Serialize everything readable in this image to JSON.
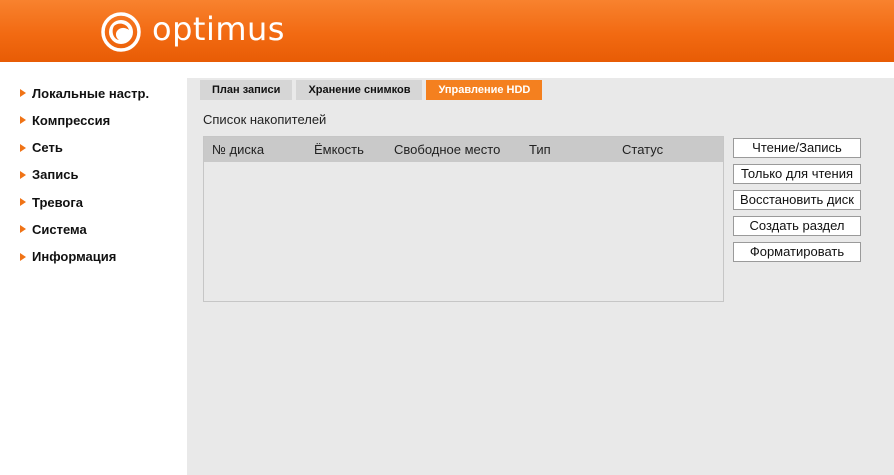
{
  "header": {
    "brand": "optimus",
    "logo_icon": "optimus-logo-icon",
    "brand_color": "#f26a12"
  },
  "menu": {
    "items": [
      {
        "label": "Локальные настр."
      },
      {
        "label": "Компрессия"
      },
      {
        "label": "Сеть"
      },
      {
        "label": "Запись"
      },
      {
        "label": "Тревога"
      },
      {
        "label": "Система"
      },
      {
        "label": "Информация"
      }
    ]
  },
  "tabs": [
    {
      "label": "План записи",
      "active": false
    },
    {
      "label": "Хранение снимков",
      "active": false
    },
    {
      "label": "Управление HDD",
      "active": true
    }
  ],
  "storage": {
    "title": "Список накопителей",
    "columns": [
      "№ диска",
      "Ёмкость",
      "Свободное место",
      "Тип",
      "Статус"
    ],
    "rows": []
  },
  "actions": {
    "read_write": "Чтение/Запись",
    "read_only": "Только для чтения",
    "restore_disk": "Восстановить диск",
    "create_partition": "Создать раздел",
    "format": "Форматировать"
  }
}
